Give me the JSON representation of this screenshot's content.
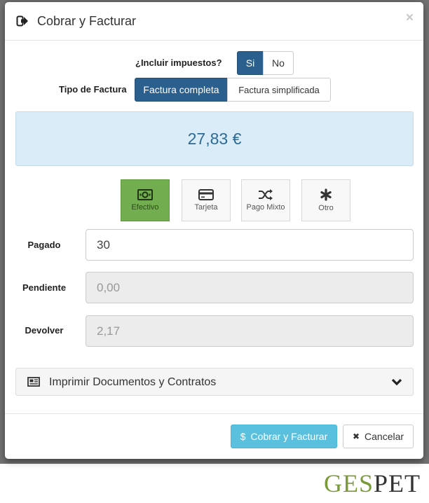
{
  "modal": {
    "title": "Cobrar y Facturar",
    "close_label": "×",
    "taxes": {
      "label": "¿Incluir impuestos?",
      "yes_label": "Si",
      "no_label": "No",
      "selected": "Si"
    },
    "invoice_type": {
      "label": "Tipo de Factura",
      "full_label": "Factura completa",
      "simplified_label": "Factura simplificada",
      "selected": "Factura completa"
    },
    "amount": "27,83 €",
    "payment_methods": [
      {
        "label": "Efectivo",
        "icon": "cash-icon",
        "active": true
      },
      {
        "label": "Tarjeta",
        "icon": "credit-card-icon",
        "active": false
      },
      {
        "label": "Pago Mixto",
        "icon": "shuffle-icon",
        "active": false
      },
      {
        "label": "Otro",
        "icon": "asterisk-icon",
        "active": false
      }
    ],
    "fields": {
      "paid_label": "Pagado",
      "paid_value": "30",
      "pending_label": "Pendiente",
      "pending_value": "0,00",
      "return_label": "Devolver",
      "return_value": "2,17"
    },
    "print_panel": {
      "label": "Imprimir Documentos y Contratos",
      "icon": "newspaper-icon",
      "chevron": "chevron-down-icon"
    },
    "footer": {
      "submit_label": "Cobrar y Facturar",
      "submit_icon": "$",
      "cancel_label": "Cancelar",
      "cancel_icon": "✖"
    }
  },
  "logo": {
    "part1": "GES",
    "part2": "PET"
  },
  "colors": {
    "primary": "#2b5f8e",
    "info": "#5bc0de",
    "success": "#72ae4f",
    "amount_bg": "#d9ecf8",
    "amount_text": "#2e6b94"
  }
}
